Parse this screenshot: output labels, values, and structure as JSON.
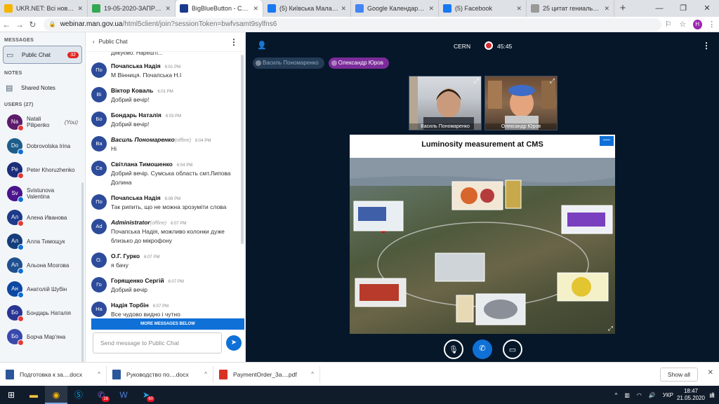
{
  "browser": {
    "tabs": [
      {
        "label": "UKR.NET: Всі новини України",
        "color": "#f4b400"
      },
      {
        "label": "19-05-2020-ЗАПРОШЕННЯ",
        "color": "#34a853"
      },
      {
        "label": "BigBlueButton - CERN",
        "color": "#1a3a8c",
        "active": true
      },
      {
        "label": "(5) Київська Мала академія",
        "color": "#1877f2"
      },
      {
        "label": "Google Календарь - календарь",
        "color": "#4285f4"
      },
      {
        "label": "(5) Facebook",
        "color": "#1877f2"
      },
      {
        "label": "25 цитат гениальных людей",
        "color": "#999999"
      }
    ],
    "new_tab": "+",
    "window_controls": [
      "—",
      "❐",
      "✕"
    ],
    "url_host": "webinar.man.gov.ua",
    "url_path": "/html5client/join?sessionToken=bwfvsamt9sylfns6",
    "profile_initial": "Н"
  },
  "left": {
    "messages_header": "MESSAGES",
    "public_chat": "Public Chat",
    "public_chat_badge": "32",
    "notes_header": "NOTES",
    "shared_notes": "Shared Notes",
    "users_header": "USERS (27)",
    "users": [
      {
        "initials": "Na",
        "name": "Natali Pilipenko",
        "suffix": " (You)",
        "color": "#5c1b6b",
        "status": "muted"
      },
      {
        "initials": "Do",
        "name": "Dobrovolska Irina",
        "color": "#1d5d8a",
        "status": "listen"
      },
      {
        "initials": "Pe",
        "name": "Peter Khoruzhenko",
        "color": "#1a2e7a",
        "status": "muted"
      },
      {
        "initials": "Sv",
        "name": "Svistunova Valentina",
        "color": "#4a148c",
        "status": "listen"
      },
      {
        "initials": "Ал",
        "name": "Алена Иванова",
        "color": "#1e3a8a",
        "status": "muted"
      },
      {
        "initials": "Ал",
        "name": "Алла Тимощук",
        "color": "#143d7a",
        "status": "listen"
      },
      {
        "initials": "Ал",
        "name": "Альона Мозгова",
        "color": "#1f4f8f",
        "status": "listen"
      },
      {
        "initials": "Ан",
        "name": "Анатолій Шубін",
        "color": "#0d47a1",
        "status": "listen"
      },
      {
        "initials": "Бо",
        "name": "Бондарь Наталія",
        "color": "#283593",
        "status": "muted"
      },
      {
        "initials": "Бо",
        "name": "Борча Мар'яна",
        "color": "#3949ab",
        "status": "muted"
      }
    ]
  },
  "chat": {
    "header": "Public Chat",
    "cut_text": "Дякуємо. Нарешті...",
    "messages": [
      {
        "initials": "По",
        "name": "Почапська Надія",
        "time": "6:01 PM",
        "text": "М Вінниця. Почапська Н.І"
      },
      {
        "initials": "Ві",
        "name": "Віктор Коваль",
        "time": "6:01 PM",
        "text": "Добрий вечір!"
      },
      {
        "initials": "Бо",
        "name": "Бондарь Наталія",
        "time": "6:03 PM",
        "text": "Добрий вечір!"
      },
      {
        "initials": "Ва",
        "name": "Василь Пономаренко",
        "offline": "(offline)",
        "time": "6:04 PM",
        "text": "Hi",
        "italic": true
      },
      {
        "initials": "Св",
        "name": "Світлана Тимошенко",
        "time": "6:04 PM",
        "text": "Добрий вечір. Сумська область смт.Липова Долина"
      },
      {
        "initials": "По",
        "name": "Почапська Надія",
        "time": "6:06 PM",
        "text": "Так рипить, що не можна зрозуміти слова"
      },
      {
        "initials": "Ad",
        "name": "Administrator",
        "offline": "(offline)",
        "time": "6:07 PM",
        "text": "Почапська Надія, можливо колонки дуже близько до мікрофону",
        "italic": true
      },
      {
        "initials": "О.",
        "name": "О.Г. Гурко",
        "time": "6:07 PM",
        "text": "я бачу"
      },
      {
        "initials": "Го",
        "name": "Горященко Сергій",
        "time": "6:07 PM",
        "text": "Добрий вечір"
      },
      {
        "initials": "На",
        "name": "Надія Торбін",
        "time": "6:07 PM",
        "text": "Все чудово видно і чутно"
      }
    ],
    "more_below": "MORE MESSAGES BELOW",
    "input_placeholder": "Send message to Public Chat"
  },
  "meeting": {
    "title": "CERN",
    "timer": "45:45",
    "talkers": [
      "Василь Пономаренко",
      "Олександр Юров"
    ],
    "cameras": [
      "Василь Пономаренко",
      "Олександр Юров"
    ],
    "slide_title": "Luminosity measurement at CMS",
    "slide_min": "—"
  },
  "downloads": [
    {
      "name": "Подготовка к за....docx",
      "color": "#2b579a"
    },
    {
      "name": "Руководство по....docx",
      "color": "#2b579a"
    },
    {
      "name": "PaymentOrder_3a....pdf",
      "color": "#d93025"
    }
  ],
  "show_all": "Show all",
  "taskbar": {
    "lang": "УКР",
    "time": "18:47",
    "date": "21.05.2020",
    "notif": "6",
    "badge_viber": "16",
    "badge_telegram": "60"
  }
}
